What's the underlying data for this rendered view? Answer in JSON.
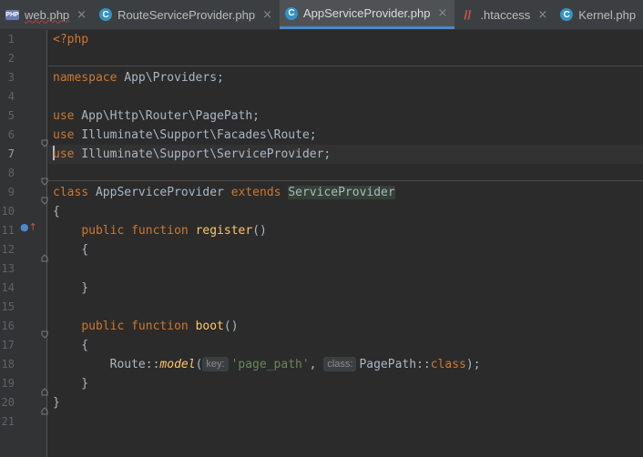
{
  "tabs": [
    {
      "label": "web.php",
      "icon": "php-file-icon",
      "icon_text": "PHP",
      "active": false
    },
    {
      "label": "RouteServiceProvider.php",
      "icon": "php-class-icon",
      "icon_text": "C",
      "active": false
    },
    {
      "label": "AppServiceProvider.php",
      "icon": "php-class-icon",
      "icon_text": "C",
      "active": true
    },
    {
      "label": ".htaccess",
      "icon": "htaccess-icon",
      "icon_text": "//",
      "active": false
    },
    {
      "label": "Kernel.php",
      "icon": "php-class-icon",
      "icon_text": "C",
      "active": false
    }
  ],
  "close_glyph": "×",
  "gutter": {
    "line_numbers": [
      "1",
      "2",
      "3",
      "4",
      "5",
      "6",
      "7",
      "8",
      "9",
      "10",
      "11",
      "12",
      "13",
      "14",
      "15",
      "16",
      "17",
      "18",
      "19",
      "20",
      "21"
    ],
    "current_line": "7",
    "override_marker": "↑"
  },
  "code": {
    "l1": {
      "t1": "<?php"
    },
    "l3": {
      "kw": "namespace",
      "t": " App\\Providers;"
    },
    "l5": {
      "kw": "use",
      "t": " App\\Http\\Router\\PagePath;"
    },
    "l6": {
      "kw": "use",
      "t": " Illuminate\\Support\\Facades\\Route;"
    },
    "l7": {
      "kw": "use",
      "t": " Illuminate\\Support\\ServiceProvider;"
    },
    "l9": {
      "kw1": "class",
      "t1": " AppServiceProvider ",
      "kw2": "extends",
      "sp": " ",
      "hl": "ServiceProvider"
    },
    "l10": {
      "t": "{"
    },
    "l11": {
      "ind": "    ",
      "kw1": "public",
      "sp": " ",
      "kw2": "function",
      "sp2": " ",
      "fn": "register",
      "t": "()"
    },
    "l12": {
      "t": "    {"
    },
    "l14": {
      "t": "    }"
    },
    "l16": {
      "ind": "    ",
      "kw1": "public",
      "sp": " ",
      "kw2": "function",
      "sp2": " ",
      "fn": "boot",
      "t": "()"
    },
    "l17": {
      "t": "    {"
    },
    "l18": {
      "ind": "        ",
      "t1": "Route::",
      "it": "model",
      "t2": "(",
      "hint1": "key:",
      "st": "'page_path'",
      "t3": ", ",
      "hint2": "class:",
      "t4": "PagePath::",
      "kw": "class",
      "t5": ");"
    },
    "l19": {
      "t": "    }"
    },
    "l20": {
      "t": "}"
    }
  },
  "colors": {
    "keyword": "#cc7832",
    "function": "#ffc66d",
    "string": "#6a8759",
    "text": "#a9b7c6",
    "background": "#2b2b2b",
    "active_tab_underline": "#4a88c7"
  }
}
